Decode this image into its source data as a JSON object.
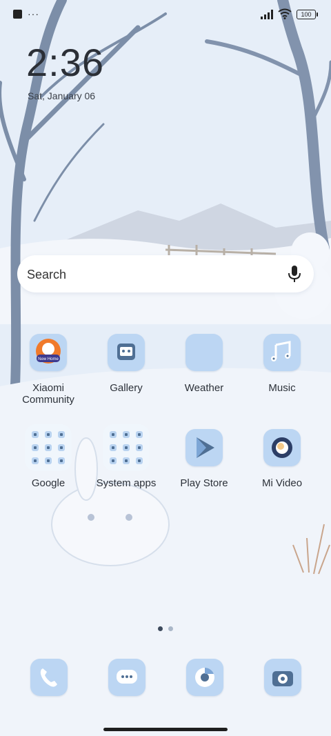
{
  "status_bar": {
    "notification_dots": "···",
    "battery": "100",
    "icons": [
      "signal-icon",
      "wifi-icon",
      "battery-icon"
    ]
  },
  "clock": {
    "time": "2:36",
    "date": "Sat, January 06"
  },
  "search": {
    "placeholder": "Search",
    "icon": "mic-icon"
  },
  "apps": [
    {
      "label": "Xiaomi Community",
      "icon": "xiaomi-community-icon"
    },
    {
      "label": "Gallery",
      "icon": "gallery-icon"
    },
    {
      "label": "Weather",
      "icon": "weather-icon"
    },
    {
      "label": "Music",
      "icon": "music-icon"
    },
    {
      "label": "Google",
      "icon": "google-folder-icon"
    },
    {
      "label": "System apps",
      "icon": "system-apps-folder-icon"
    },
    {
      "label": "Play Store",
      "icon": "play-store-icon"
    },
    {
      "label": "Mi Video",
      "icon": "mi-video-icon"
    }
  ],
  "xiaomi_badge": "New Home",
  "pages": {
    "count": 2,
    "current": 1
  },
  "dock": [
    {
      "icon": "phone-icon"
    },
    {
      "icon": "messages-icon"
    },
    {
      "icon": "chrome-icon"
    },
    {
      "icon": "camera-icon"
    }
  ],
  "colors": {
    "icon_bg": "#bcd6f3",
    "icon_fg": "#ffffff",
    "accent": "#f07a2b"
  }
}
